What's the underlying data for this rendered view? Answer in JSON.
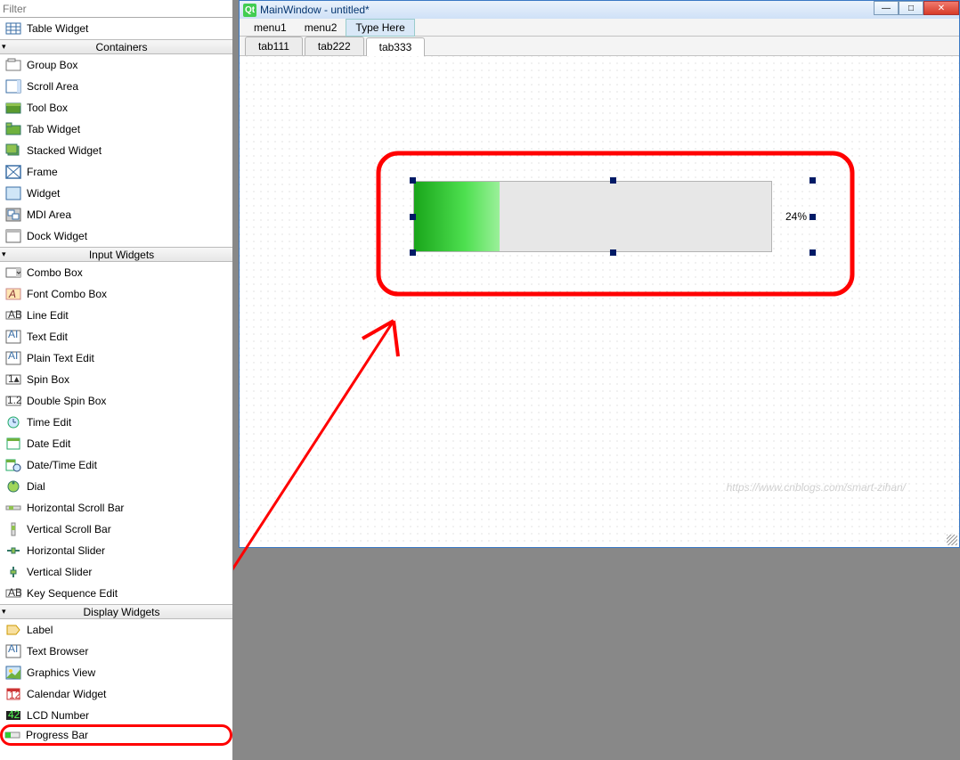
{
  "filter_placeholder": "Filter",
  "widget_top_item": "Table Widget",
  "categories": [
    {
      "title": "Containers",
      "items": [
        "Group Box",
        "Scroll Area",
        "Tool Box",
        "Tab Widget",
        "Stacked Widget",
        "Frame",
        "Widget",
        "MDI Area",
        "Dock Widget"
      ]
    },
    {
      "title": "Input Widgets",
      "items": [
        "Combo Box",
        "Font Combo Box",
        "Line Edit",
        "Text Edit",
        "Plain Text Edit",
        "Spin Box",
        "Double Spin Box",
        "Time Edit",
        "Date Edit",
        "Date/Time Edit",
        "Dial",
        "Horizontal Scroll Bar",
        "Vertical Scroll Bar",
        "Horizontal Slider",
        "Vertical Slider",
        "Key Sequence Edit"
      ]
    },
    {
      "title": "Display Widgets",
      "items": [
        "Label",
        "Text Browser",
        "Graphics View",
        "Calendar Widget",
        "LCD Number",
        "Progress Bar"
      ]
    }
  ],
  "highlighted_item": "Progress Bar",
  "designer": {
    "window_title": "MainWindow - untitled*",
    "menus": [
      "menu1",
      "menu2"
    ],
    "menu_typehere": "Type Here",
    "tabs": [
      "tab111",
      "tab222",
      "tab333"
    ],
    "active_tab": "tab333",
    "progress_percent_label": "24%",
    "progress_percent_value": 24,
    "watermark": "https://www.cnblogs.com/smart-zihan/"
  },
  "winbtn_min": "—",
  "winbtn_max": "□",
  "winbtn_close": "✕"
}
